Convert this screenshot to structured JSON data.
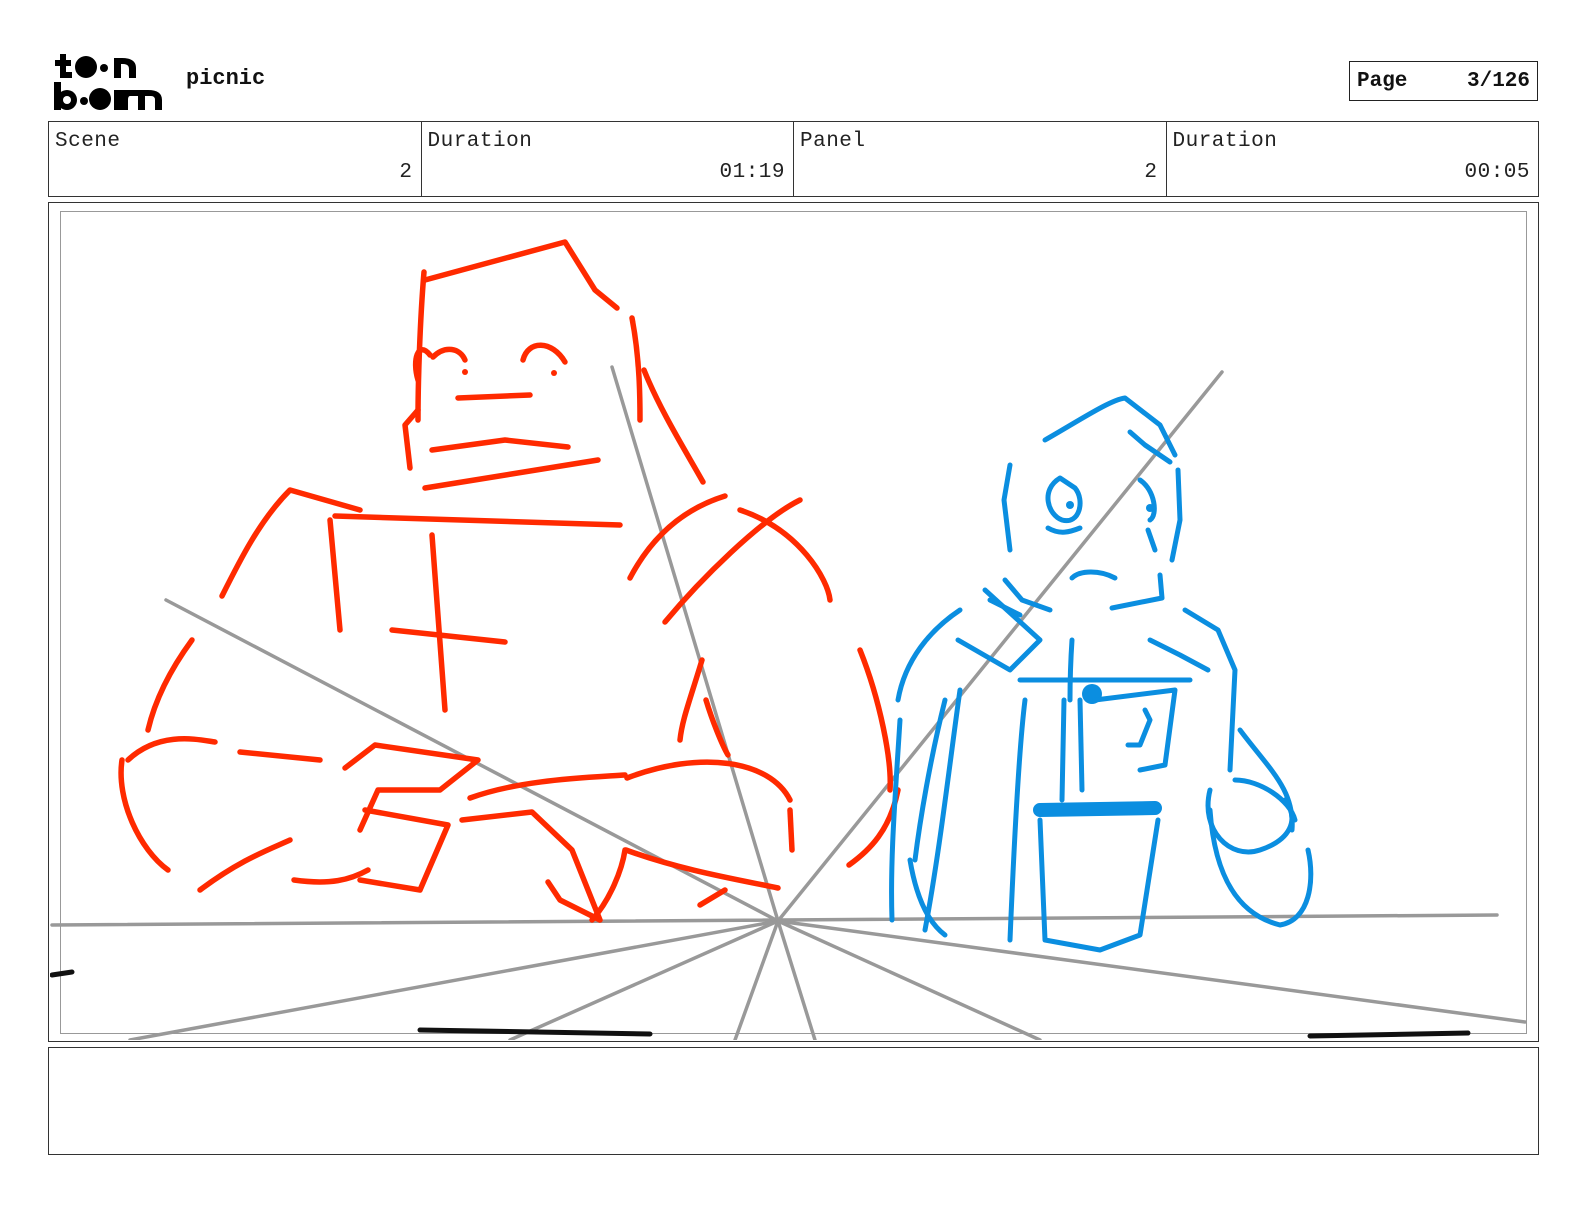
{
  "header": {
    "logo_text": "toonboom",
    "project_title": "picnic",
    "page_label": "Page",
    "page_number": "3/126"
  },
  "info": {
    "scene_label": "Scene",
    "scene_value": "2",
    "scene_duration_label": "Duration",
    "scene_duration_value": "01:19",
    "panel_label": "Panel",
    "panel_value": "2",
    "panel_duration_label": "Duration",
    "panel_duration_value": "00:05"
  },
  "sketch": {
    "colors": {
      "large_character": "#ff2a00",
      "small_character": "#0b8ee0",
      "perspective_lines": "#999999",
      "floor_marks": "#111111"
    }
  },
  "notes": {
    "text": ""
  }
}
